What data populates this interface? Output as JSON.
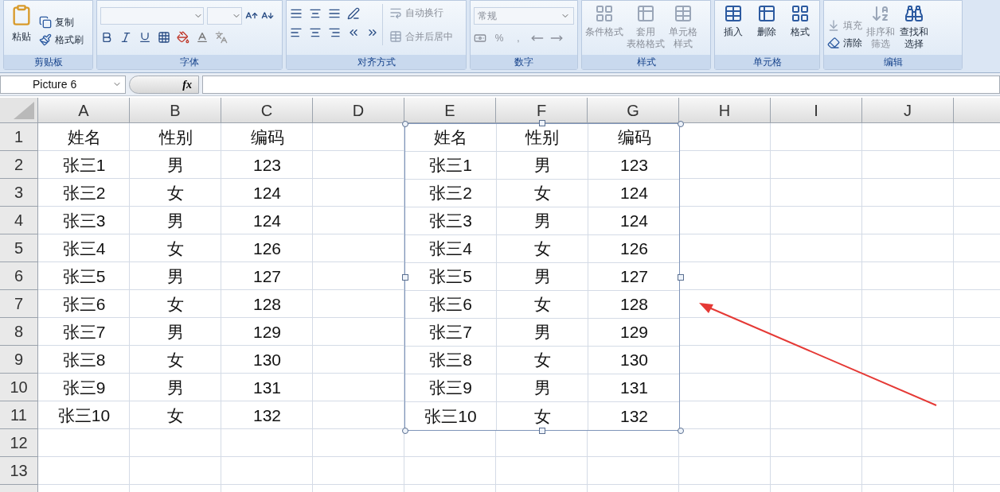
{
  "ribbon": {
    "groups": [
      {
        "kind": "clipboard",
        "label": "剪贴板",
        "large": [
          {
            "label": "粘贴"
          }
        ],
        "small": [
          {
            "label": "复制",
            "disabled": false
          },
          {
            "label": "格式刷",
            "disabled": false
          }
        ]
      },
      {
        "kind": "font",
        "label": "字体"
      },
      {
        "kind": "alignment",
        "label": "对齐方式",
        "small": [
          {
            "label": "自动换行",
            "disabled": true
          },
          {
            "label": "合并后居中",
            "disabled": true
          }
        ]
      },
      {
        "kind": "number",
        "label": "数字",
        "format": "常规",
        "symbols": [
          "%",
          ","
        ]
      },
      {
        "kind": "styles",
        "label": "样式",
        "large": [
          {
            "lines": [
              "条件格式"
            ],
            "disabled": true
          },
          {
            "lines": [
              "套用",
              "表格格式"
            ],
            "disabled": true
          },
          {
            "lines": [
              "单元格",
              "样式"
            ],
            "disabled": true
          }
        ]
      },
      {
        "kind": "cells",
        "label": "单元格",
        "large": [
          {
            "lines": [
              "插入"
            ],
            "disabled": false
          },
          {
            "lines": [
              "删除"
            ],
            "disabled": false
          },
          {
            "lines": [
              "格式"
            ],
            "disabled": false
          }
        ]
      },
      {
        "kind": "editing",
        "label": "编辑",
        "small": [
          {
            "label": "填充",
            "disabled": true
          },
          {
            "label": "清除",
            "disabled": false
          }
        ],
        "large": [
          {
            "lines": [
              "排序和",
              "筛选"
            ],
            "disabled": true
          },
          {
            "lines": [
              "查找和",
              "选择"
            ],
            "disabled": false
          }
        ]
      }
    ]
  },
  "formula_bar": {
    "name_box": "Picture 6",
    "function_label": "fx"
  },
  "sheet": {
    "columns": [
      "A",
      "B",
      "C",
      "D",
      "E",
      "F",
      "G",
      "H",
      "I",
      "J"
    ],
    "rows": [
      {
        "number": "1",
        "cells": [
          "姓名",
          "性别",
          "编码"
        ]
      },
      {
        "number": "2",
        "cells": [
          "张三1",
          "男",
          "123"
        ]
      },
      {
        "number": "3",
        "cells": [
          "张三2",
          "女",
          "124"
        ]
      },
      {
        "number": "4",
        "cells": [
          "张三3",
          "男",
          "124"
        ]
      },
      {
        "number": "5",
        "cells": [
          "张三4",
          "女",
          "126"
        ]
      },
      {
        "number": "6",
        "cells": [
          "张三5",
          "男",
          "127"
        ]
      },
      {
        "number": "7",
        "cells": [
          "张三6",
          "女",
          "128"
        ]
      },
      {
        "number": "8",
        "cells": [
          "张三7",
          "男",
          "129"
        ]
      },
      {
        "number": "9",
        "cells": [
          "张三8",
          "女",
          "130"
        ]
      },
      {
        "number": "10",
        "cells": [
          "张三9",
          "男",
          "131"
        ]
      },
      {
        "number": "11",
        "cells": [
          "张三10",
          "女",
          "132"
        ]
      },
      {
        "number": "12"
      },
      {
        "number": "13"
      }
    ]
  },
  "pasted_picture": {
    "selected": true,
    "rows": [
      [
        "姓名",
        "性别",
        "编码"
      ],
      [
        "张三1",
        "男",
        "123"
      ],
      [
        "张三2",
        "女",
        "124"
      ],
      [
        "张三3",
        "男",
        "124"
      ],
      [
        "张三4",
        "女",
        "126"
      ],
      [
        "张三5",
        "男",
        "127"
      ],
      [
        "张三6",
        "女",
        "128"
      ],
      [
        "张三7",
        "男",
        "129"
      ],
      [
        "张三8",
        "女",
        "130"
      ],
      [
        "张三9",
        "男",
        "131"
      ],
      [
        "张三10",
        "女",
        "132"
      ]
    ]
  }
}
